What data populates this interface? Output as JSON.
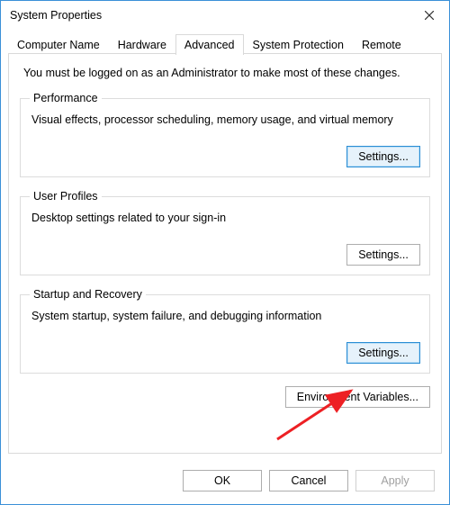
{
  "window": {
    "title": "System Properties"
  },
  "tabs": {
    "t0": "Computer Name",
    "t1": "Hardware",
    "t2": "Advanced",
    "t3": "System Protection",
    "t4": "Remote",
    "active": "Advanced"
  },
  "panel": {
    "intro": "You must be logged on as an Administrator to make most of these changes.",
    "performance": {
      "legend": "Performance",
      "desc": "Visual effects, processor scheduling, memory usage, and virtual memory",
      "button": "Settings..."
    },
    "userprofiles": {
      "legend": "User Profiles",
      "desc": "Desktop settings related to your sign-in",
      "button": "Settings..."
    },
    "startup": {
      "legend": "Startup and Recovery",
      "desc": "System startup, system failure, and debugging information",
      "button": "Settings..."
    },
    "env_button": "Environment Variables..."
  },
  "buttons": {
    "ok": "OK",
    "cancel": "Cancel",
    "apply": "Apply"
  },
  "annotation": {
    "arrow_color": "#ed2024"
  }
}
